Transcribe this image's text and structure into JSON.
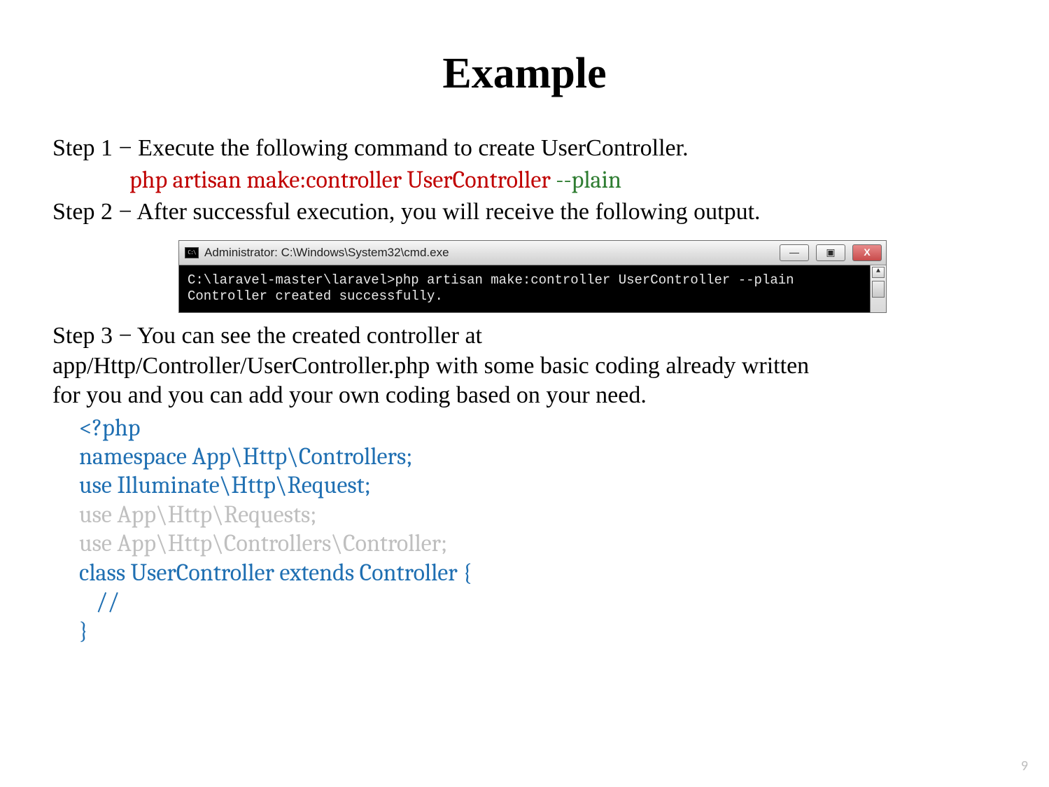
{
  "title": "Example",
  "step1": {
    "text": "Step 1 − Execute the following command to create UserController.",
    "cmd_main": "php artisan make:controller UserController ",
    "cmd_flag": "--plain"
  },
  "step2": {
    "text": "Step 2 − After successful execution, you will receive the following output."
  },
  "terminal": {
    "icon_label": "C:\\",
    "title": "Administrator: C:\\Windows\\System32\\cmd.exe",
    "min": "—",
    "max": "▣",
    "close": "X",
    "scroll_up": "▲",
    "line1": "C:\\laravel-master\\laravel>php artisan make:controller UserController --plain",
    "line2": "Controller created successfully."
  },
  "step3": {
    "line1": "Step 3 − You can see the created controller at",
    "line2": "app/Http/Controller/UserController.php with some basic coding already written",
    "line3": "for you and you can add your own coding based on your need."
  },
  "code": {
    "l1": "<?php",
    "l2": "namespace App\\Http\\Controllers;",
    "l3": "use Illuminate\\Http\\Request;",
    "l4": "use App\\Http\\Requests;",
    "l5": "use App\\Http\\Controllers\\Controller;",
    "l6": "",
    "l7": "class UserController extends Controller {",
    "l8": "//",
    "l9": "}"
  },
  "page_number": "9"
}
